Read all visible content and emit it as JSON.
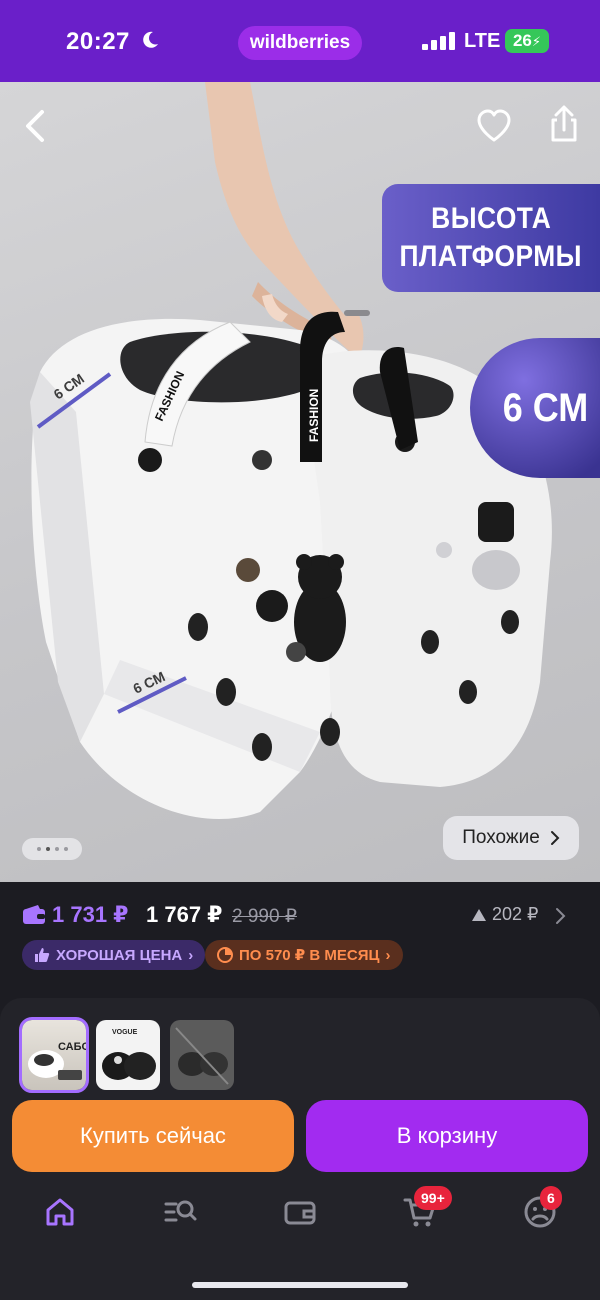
{
  "status_bar": {
    "time": "20:27",
    "brand": "wildberries",
    "network": "LTE",
    "battery": "26"
  },
  "product_image": {
    "banner_line1": "ВЫСОТА",
    "banner_line2": "ПЛАТФОРМЫ",
    "size_badge": "6 СМ",
    "dimension_label_top": "6 СМ",
    "dimension_label_bottom": "6 СМ",
    "strap_text": "FASHION",
    "similar_label": "Похожие"
  },
  "price": {
    "wallet_price": "1 731 ₽",
    "regular_price": "1 767 ₽",
    "old_price": "2 990 ₽",
    "price_drop": "202 ₽",
    "badge_good_price": "ХОРОШАЯ ЦЕНА",
    "badge_installment": "ПО 570 ₽ В МЕСЯЦ"
  },
  "thumbnails": {
    "thumb1_text": "САБО",
    "thumb2_text": "VOGUE"
  },
  "actions": {
    "buy_now": "Купить сейчас",
    "add_to_cart": "В корзину"
  },
  "tabbar": {
    "cart_badge": "99+",
    "profile_badge": "6"
  },
  "colors": {
    "brand_purple": "#6a1fc9",
    "accent_purple": "#a22bf0",
    "orange": "#f48c35",
    "badge_red": "#e8243c"
  }
}
